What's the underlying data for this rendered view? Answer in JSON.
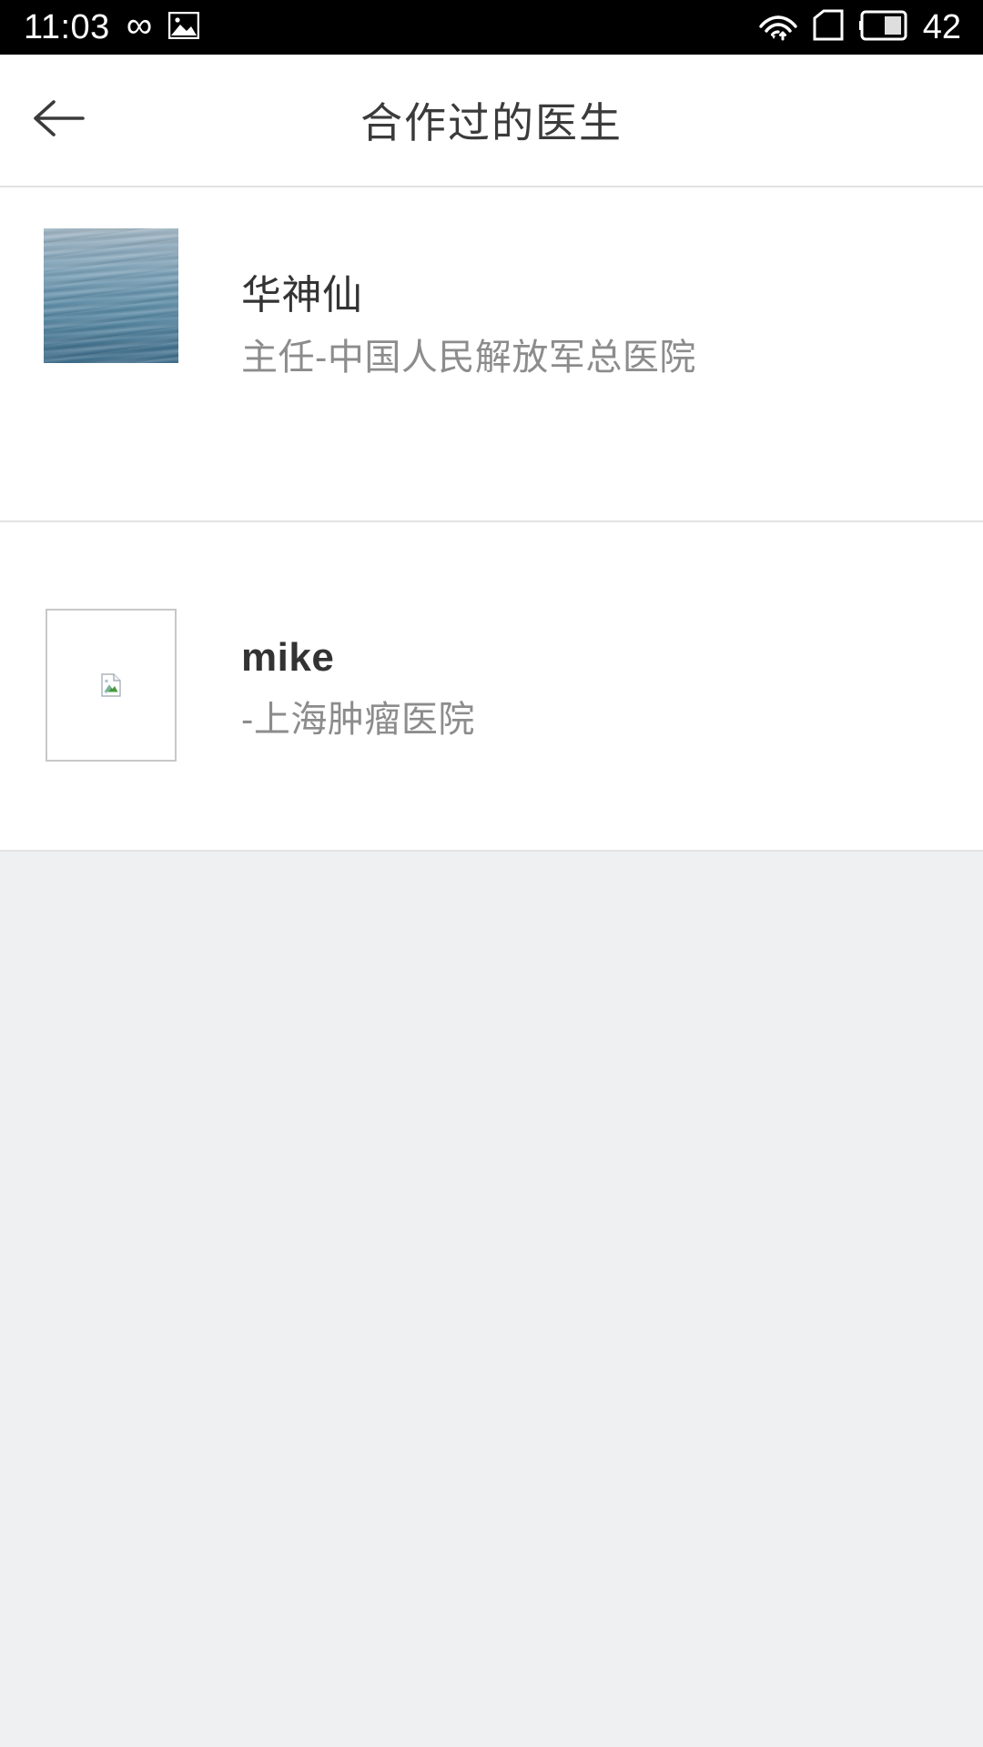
{
  "status_bar": {
    "time": "11:03",
    "battery_percent": "42",
    "icons_left": [
      "infinity-icon",
      "gallery-image-icon"
    ],
    "icons_right": [
      "wifi-upload-icon",
      "sim-card-icon",
      "battery-icon"
    ],
    "background_color": "#000000",
    "foreground_color": "#ffffff"
  },
  "header": {
    "title": "合作过的医生",
    "back_icon": "back-arrow-icon",
    "background_color": "#ffffff",
    "title_color": "#3b3b3b"
  },
  "list": {
    "items": [
      {
        "name": "华神仙",
        "subtitle": "主任-中国人民解放军总医院",
        "avatar_type": "photo",
        "avatar_icon": "water-photo-avatar"
      },
      {
        "name": "mike",
        "subtitle": "-上海肿瘤医院",
        "avatar_type": "broken",
        "avatar_icon": "broken-image-icon"
      }
    ]
  },
  "colors": {
    "page_background": "#eff0f1",
    "card_background": "#ffffff",
    "divider": "#e2e2e2",
    "name_text": "#333333",
    "subtitle_text": "#8c8c8c"
  }
}
